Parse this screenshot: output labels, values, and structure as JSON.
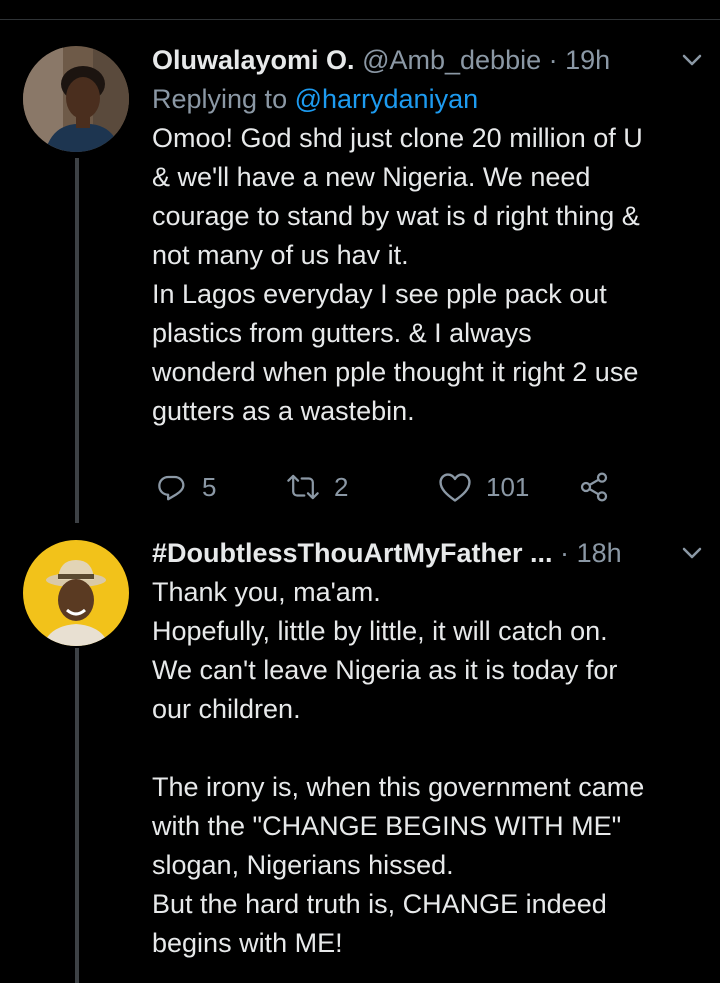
{
  "tweets": [
    {
      "display_name": "Oluwalayomi O.",
      "handle": "@Amb_debbie",
      "separator": "·",
      "time": "19h",
      "replying_prefix": "Replying to ",
      "replying_to": "@harrydaniyan",
      "text": "Omoo! God shd just clone 20 million of U\n& we'll have a new Nigeria. We need\ncourage to stand by wat is d right thing &\nnot many of us hav it.\nIn Lagos everyday I see pple pack out\nplastics from gutters. & I always\nwonderd when pple thought it right 2 use\ngutters as a wastebin.",
      "replies": "5",
      "retweets": "2",
      "likes": "101"
    },
    {
      "display_name": "#DoubtlessThouArtMyFather ...",
      "separator": "·",
      "time": "18h",
      "text": "Thank you, ma'am.\nHopefully, little by little, it will catch on.\nWe can't leave Nigeria as it is today for\nour children.\n\nThe irony is, when this government came\nwith the \"CHANGE BEGINS WITH ME\"\nslogan, Nigerians hissed.\nBut the hard truth is, CHANGE indeed\nbegins with ME!"
    }
  ],
  "icons": [
    "reply-icon",
    "retweet-icon",
    "like-icon",
    "share-icon",
    "chevron-down-icon"
  ],
  "colors": {
    "background": "#000000",
    "text": "#e7e9ea",
    "secondary": "#8b98a5",
    "accent": "#1d9bf0",
    "thread_line": "#3d4145"
  }
}
